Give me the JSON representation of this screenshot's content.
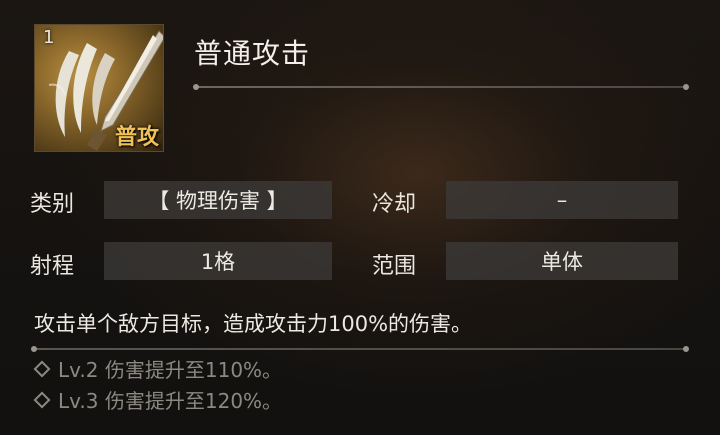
{
  "skill": {
    "level": "1",
    "tag": "普攻",
    "name": "普通攻击",
    "icon": "claw-slash-icon"
  },
  "attributes": {
    "category_label": "类别",
    "category_value": "【 物理伤害 】",
    "cooldown_label": "冷却",
    "cooldown_value": "–",
    "range_label": "射程",
    "range_value": "1格",
    "area_label": "范围",
    "area_value": "单体"
  },
  "description": "攻击单个敌方目标，造成攻击力100%的伤害。",
  "upgrades": [
    "Lv.2 伤害提升至110%。",
    "Lv.3 伤害提升至120%。"
  ],
  "colors": {
    "tag": "#f0c156",
    "value_box": "#3c3a38",
    "upgrade_text": "#8c8882"
  }
}
